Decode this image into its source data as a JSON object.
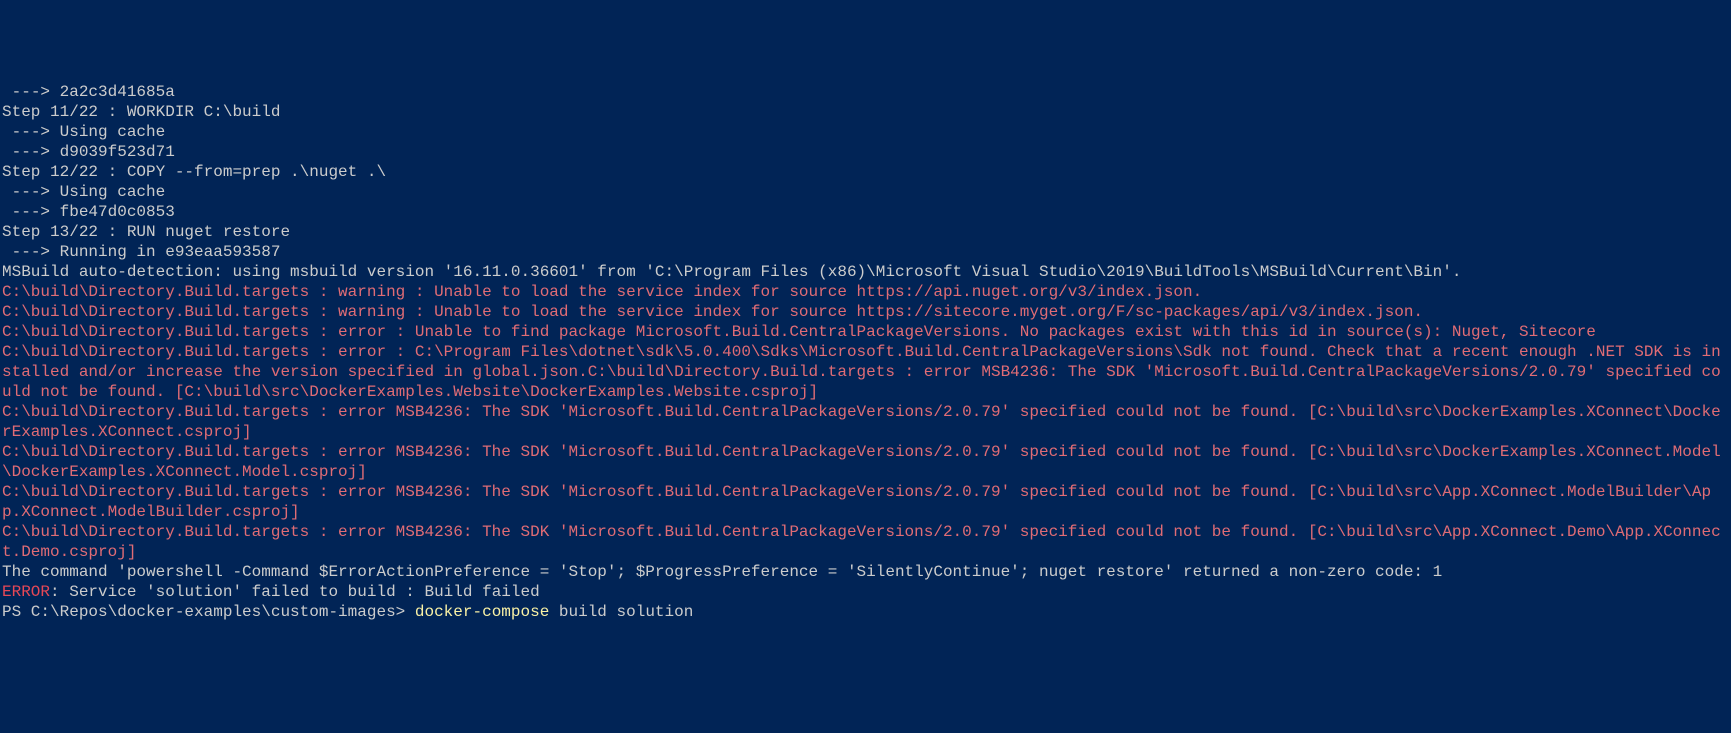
{
  "lines": {
    "l1": " ---> 2a2c3d41685a",
    "l2": "Step 11/22 : WORKDIR C:\\build",
    "l3": " ---> Using cache",
    "l4": " ---> d9039f523d71",
    "l5": "Step 12/22 : COPY --from=prep .\\nuget .\\",
    "l6": " ---> Using cache",
    "l7": " ---> fbe47d0c0853",
    "l8": "Step 13/22 : RUN nuget restore",
    "l9": " ---> Running in e93eaa593587",
    "l10": "MSBuild auto-detection: using msbuild version '16.11.0.36601' from 'C:\\Program Files (x86)\\Microsoft Visual Studio\\2019\\BuildTools\\MSBuild\\Current\\Bin'.",
    "l11": "C:\\build\\Directory.Build.targets : warning : Unable to load the service index for source https://api.nuget.org/v3/index.json.",
    "l12": "C:\\build\\Directory.Build.targets : warning : Unable to load the service index for source https://sitecore.myget.org/F/sc-packages/api/v3/index.json.",
    "l13": "C:\\build\\Directory.Build.targets : error : Unable to find package Microsoft.Build.CentralPackageVersions. No packages exist with this id in source(s): Nuget, Sitecore",
    "l14": "C:\\build\\Directory.Build.targets : error : C:\\Program Files\\dotnet\\sdk\\5.0.400\\Sdks\\Microsoft.Build.CentralPackageVersions\\Sdk not found. Check that a recent enough .NET SDK is installed and/or increase the version specified in global.json.C:\\build\\Directory.Build.targets : error MSB4236: The SDK 'Microsoft.Build.CentralPackageVersions/2.0.79' specified could not be found. [C:\\build\\src\\DockerExamples.Website\\DockerExamples.Website.csproj]",
    "l15": "C:\\build\\Directory.Build.targets : error MSB4236: The SDK 'Microsoft.Build.CentralPackageVersions/2.0.79' specified could not be found. [C:\\build\\src\\DockerExamples.XConnect\\DockerExamples.XConnect.csproj]",
    "l16": "C:\\build\\Directory.Build.targets : error MSB4236: The SDK 'Microsoft.Build.CentralPackageVersions/2.0.79' specified could not be found. [C:\\build\\src\\DockerExamples.XConnect.Model\\DockerExamples.XConnect.Model.csproj]",
    "l17": "C:\\build\\Directory.Build.targets : error MSB4236: The SDK 'Microsoft.Build.CentralPackageVersions/2.0.79' specified could not be found. [C:\\build\\src\\App.XConnect.ModelBuilder\\App.XConnect.ModelBuilder.csproj]",
    "l18": "C:\\build\\Directory.Build.targets : error MSB4236: The SDK 'Microsoft.Build.CentralPackageVersions/2.0.79' specified could not be found. [C:\\build\\src\\App.XConnect.Demo\\App.XConnect.Demo.csproj]",
    "l19": "",
    "l20": "The command 'powershell -Command $ErrorActionPreference = 'Stop'; $ProgressPreference = 'SilentlyContinue'; nuget restore' returned a non-zero code: 1",
    "l21a": "ERROR",
    "l21b": ": Service 'solution' failed to build : Build failed",
    "l22a": "PS C:\\Repos\\docker-examples\\custom-images> ",
    "l22b": "docker-compose",
    "l22c": " build solution"
  }
}
